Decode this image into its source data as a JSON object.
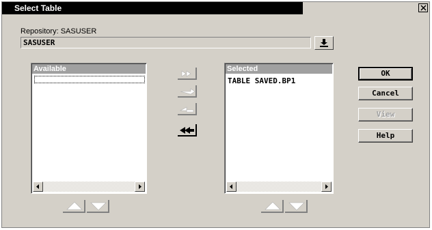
{
  "window": {
    "title": "Select Table",
    "close_glyph": "×"
  },
  "repository": {
    "label": "Repository: SASUSER",
    "value": "SASUSER",
    "dropdown_icon": "down-arrow-icon"
  },
  "available": {
    "header": "Available",
    "items": [
      ""
    ]
  },
  "selected": {
    "header": "Selected",
    "items": [
      "TABLE SAVED.BP1"
    ]
  },
  "move_buttons": [
    {
      "name": "move-all-right-button",
      "icon": "double-right-arrow-icon",
      "enabled": false
    },
    {
      "name": "move-right-button",
      "icon": "right-arrow-icon",
      "enabled": false
    },
    {
      "name": "move-left-button",
      "icon": "left-arrow-icon",
      "enabled": false
    },
    {
      "name": "move-all-left-button",
      "icon": "double-left-arrow-icon",
      "enabled": true
    }
  ],
  "buttons": {
    "ok": "OK",
    "cancel": "Cancel",
    "view": "View",
    "help": "Help"
  },
  "colors": {
    "face": "#d4d0c8",
    "title": "#000000",
    "list_header": "#a0a0a0"
  }
}
